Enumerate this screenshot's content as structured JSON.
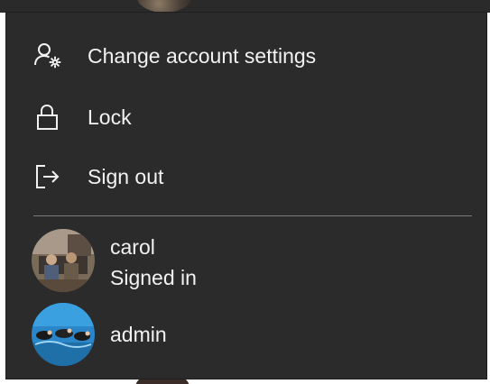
{
  "menu": {
    "items": [
      {
        "label": "Change account settings",
        "icon": "person-gear-icon"
      },
      {
        "label": "Lock",
        "icon": "lock-icon"
      },
      {
        "label": "Sign out",
        "icon": "sign-out-icon"
      }
    ]
  },
  "users": [
    {
      "name": "carol",
      "status": "Signed in",
      "avatar": "photo-avatar"
    },
    {
      "name": "admin",
      "avatar": "photo-avatar"
    }
  ],
  "colors": {
    "menu_background": "#2b2b2b",
    "text": "#f2f2f2",
    "divider": "#7a7a7a"
  }
}
